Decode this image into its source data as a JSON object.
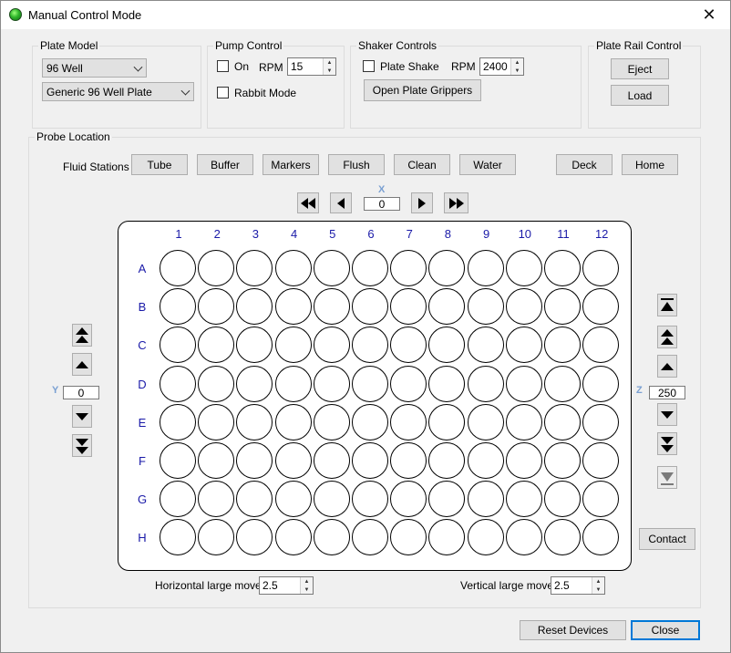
{
  "window": {
    "title": "Manual Control Mode",
    "close_glyph": "✕"
  },
  "plate_model": {
    "legend": "Plate Model",
    "type_value": "96 Well",
    "plate_value": "Generic 96 Well Plate"
  },
  "pump_control": {
    "legend": "Pump Control",
    "on_label": "On",
    "rpm_label": "RPM",
    "rpm_value": "15",
    "rabbit_label": "Rabbit Mode"
  },
  "shaker": {
    "legend": "Shaker Controls",
    "shake_label": "Plate Shake",
    "rpm_label": "RPM",
    "rpm_value": "2400",
    "grippers_label": "Open Plate Grippers"
  },
  "rail": {
    "legend": "Plate Rail Control",
    "eject_label": "Eject",
    "load_label": "Load"
  },
  "probe": {
    "legend": "Probe Location",
    "fluid_label": "Fluid Stations",
    "stations": [
      "Tube",
      "Buffer",
      "Markers",
      "Flush",
      "Clean",
      "Water"
    ],
    "deck_label": "Deck",
    "home_label": "Home",
    "x_label": "X",
    "x_value": "0",
    "y_label": "Y",
    "y_value": "0",
    "z_label": "Z",
    "z_value": "250",
    "contact_label": "Contact"
  },
  "plate": {
    "columns": [
      "1",
      "2",
      "3",
      "4",
      "5",
      "6",
      "7",
      "8",
      "9",
      "10",
      "11",
      "12"
    ],
    "rows": [
      "A",
      "B",
      "C",
      "D",
      "E",
      "F",
      "G",
      "H"
    ]
  },
  "moves": {
    "horizontal_label": "Horizontal large move:",
    "horizontal_value": "2.5",
    "vertical_label": "Vertical large move:",
    "vertical_value": "2.5"
  },
  "footer": {
    "reset_label": "Reset Devices",
    "close_label": "Close"
  },
  "icons": {
    "app": "green-led-icon",
    "nav": [
      "double-left-icon",
      "left-icon",
      "right-icon",
      "double-right-icon",
      "double-up-icon",
      "up-icon",
      "down-icon",
      "double-down-icon",
      "top-icon",
      "bottom-icon"
    ]
  }
}
